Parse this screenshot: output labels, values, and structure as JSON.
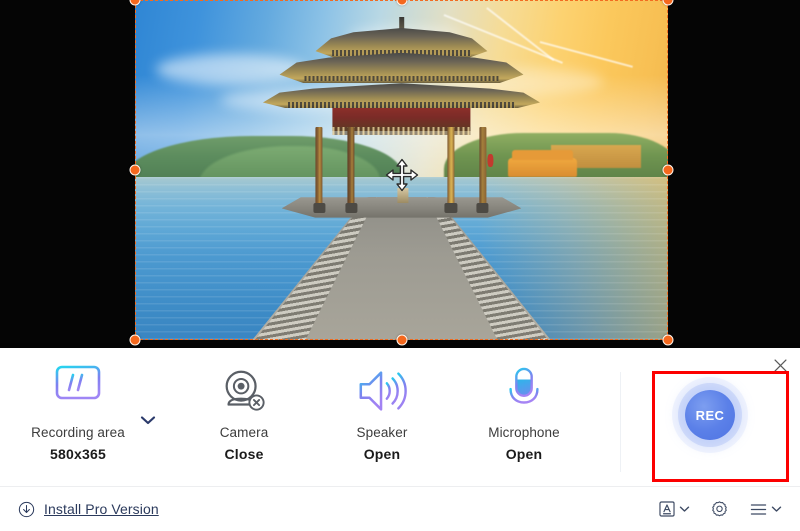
{
  "app": {
    "panel_close_label": "×"
  },
  "capture": {
    "selection_label": "capture-selection",
    "cursor": "move-cursor"
  },
  "controls": [
    {
      "id": "recording-area",
      "icon": "monitor-icon",
      "label": "Recording area",
      "value": "580x365",
      "has_dropdown": true
    },
    {
      "id": "camera",
      "icon": "webcam-off-icon",
      "label": "Camera",
      "value": "Close",
      "has_dropdown": false
    },
    {
      "id": "speaker",
      "icon": "speaker-icon",
      "label": "Speaker",
      "value": "Open",
      "has_dropdown": false
    },
    {
      "id": "microphone",
      "icon": "microphone-icon",
      "label": "Microphone",
      "value": "Open",
      "has_dropdown": false
    }
  ],
  "record": {
    "button_label": "REC",
    "highlight_color": "#fc0000"
  },
  "bottom_bar": {
    "pro_link_label": "Install Pro Version",
    "pro_link_icon": "download-circle-icon",
    "items": [
      {
        "id": "annotation",
        "icon": "text-annotation-icon",
        "caret": "˅"
      },
      {
        "id": "settings",
        "icon": "gear-icon",
        "caret": ""
      },
      {
        "id": "menu",
        "icon": "hamburger-menu-icon",
        "caret": "˅"
      }
    ]
  },
  "colors": {
    "selection_handle": "#f4681d",
    "selection_border": "#f26c21",
    "rec_blue": "#5b80e8",
    "link_blue": "#2b3a5c",
    "highlight_red": "#fc0000"
  }
}
